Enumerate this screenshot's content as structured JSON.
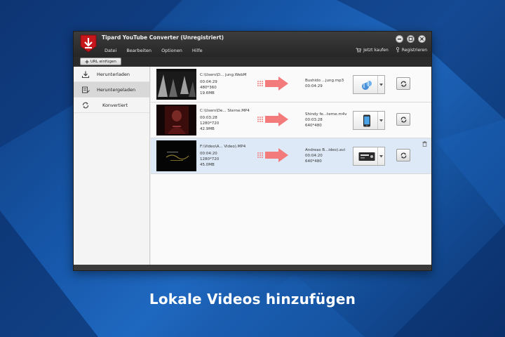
{
  "window": {
    "title": "Tipard YouTube Converter (Unregistriert)",
    "menu": [
      "Datei",
      "Bearbeiten",
      "Optionen",
      "Hilfe"
    ],
    "buy_label": "Jetzt kaufen",
    "register_label": "Registrieren"
  },
  "toolbar": {
    "url_label": "URL einfügen"
  },
  "sidebar": {
    "items": [
      {
        "label": "Herunterladen",
        "icon": "download-icon",
        "active": false
      },
      {
        "label": "Heruntergeladen",
        "icon": "downloaded-icon",
        "active": true
      },
      {
        "label": "Konvertiert",
        "icon": "converted-icon",
        "active": false
      }
    ]
  },
  "files": [
    {
      "source_name": "C:\\Users\\D... jung.WebM",
      "duration": "00:04:29",
      "resolution": "480*360",
      "size": "19.6MB",
      "target_name": "Bushido ...jung.mp3",
      "target_duration": "00:04:29",
      "target_resolution": "",
      "device_icon": "music-icon"
    },
    {
      "source_name": "C:\\Users\\De... Sterne.MP4",
      "duration": "00:03:28",
      "resolution": "1280*720",
      "size": "42.9MB",
      "target_name": "Shindy fe...terne.m4v",
      "target_duration": "00:03:28",
      "target_resolution": "640*480",
      "device_icon": "iphone-icon"
    },
    {
      "source_name": "F:\\Video\\A... Video).MP4",
      "duration": "00:04:20",
      "resolution": "1280*720",
      "size": "45.0MB",
      "target_name": "Andreas B...ideo).avi",
      "target_duration": "00:04:20",
      "target_resolution": "640*480",
      "device_icon": "dvd-player-icon"
    }
  ],
  "caption": "Lokale Videos hinzufügen",
  "colors": {
    "arrow": "#f47b7b",
    "selected_row": "#dde9f7",
    "logo_red": "#c8161d"
  }
}
